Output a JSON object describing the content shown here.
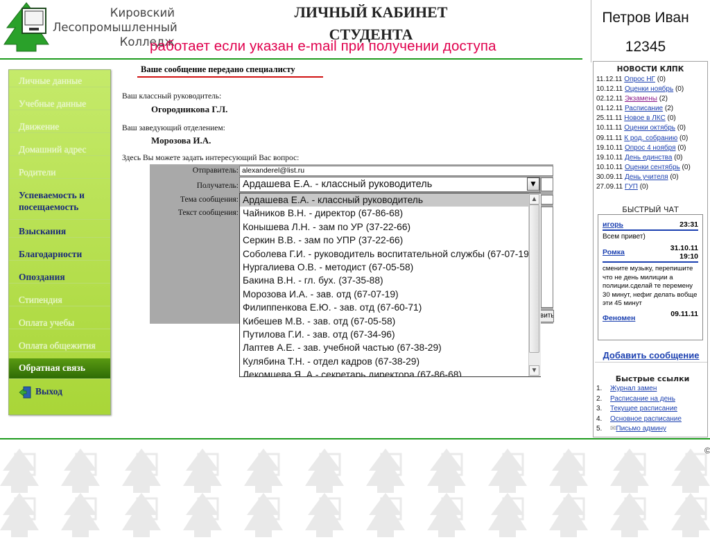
{
  "header": {
    "college_lines": [
      "Кировский",
      "Лесопромышленный",
      "Колледж"
    ],
    "title_line1": "ЛИЧНЫЙ КАБИНЕТ",
    "title_line2": "СТУДЕНТА",
    "note": "работает если указан e-mail при получении доступа",
    "user_name": "Петров Иван",
    "user_id": "12345"
  },
  "sidebar": {
    "items": [
      {
        "label": "Личные данные",
        "state": "dim"
      },
      {
        "label": "Учебные данные",
        "state": "dim"
      },
      {
        "label": "Движение",
        "state": "dim"
      },
      {
        "label": "Домашний адрес",
        "state": "dim"
      },
      {
        "label": "Родители",
        "state": "dim"
      },
      {
        "label": "Успеваемость и посещаемость",
        "state": "active"
      },
      {
        "label": "Взыскания",
        "state": "active"
      },
      {
        "label": "Благодарности",
        "state": "active"
      },
      {
        "label": "Опоздания",
        "state": "active"
      },
      {
        "label": "Стипендия",
        "state": "dim"
      },
      {
        "label": "Оплата учебы",
        "state": "dim"
      },
      {
        "label": "Оплата общежития",
        "state": "dim"
      },
      {
        "label": "Обратная связь",
        "state": "selected"
      }
    ],
    "exit_label": "Выход"
  },
  "main": {
    "message_title": "Ваше сообщение передано специалисту",
    "class_teacher_label": "Ваш классный руководитель:",
    "class_teacher_name": "Огородникова Г.Л.",
    "dept_head_label": "Ваш заведующий отделением:",
    "dept_head_name": "Морозова И.А.",
    "ask_prompt": "Здесь Вы можете задать интересующий Вас вопрос:",
    "form": {
      "sender_label": "Отправитель:",
      "sender_value": "alexanderel@list.ru",
      "recipient_label": "Получатель:",
      "recipient_value": "Ардашева Е.А. - классный руководитель",
      "subject_label": "Тема сообщения:",
      "text_label": "Текст сообщения:",
      "send_label": "Отправить"
    },
    "dropdown_options": [
      "Ардашева Е.А. - классный руководитель",
      "Чайников В.Н. - директор (67-86-68)",
      "Конышева Л.Н. - зам по УР (37-22-66)",
      "Серкин В.В. - зам по УПР (37-22-66)",
      "Соболева Г.И. - руководитель воспитательной службы (67-07-19)",
      "Нургалиева О.В. - методист (67-05-58)",
      "Бакина В.Н. - гл. бух. (37-35-88)",
      "Морозова И.А. - зав. отд (67-07-19)",
      "Филиппенкова Е.Ю. - зав. отд (67-60-71)",
      "Кибешев М.В. - зав. отд (67-05-58)",
      "Путилова Г.И. - зав. отд (67-34-96)",
      "Лаптев А.Е. - зав. учебной частью (67-38-29)",
      "Кулябина Т.Н. - отдел кадров (67-38-29)",
      "Лекомцева Я. А - секретарь директора (67-86-68)"
    ],
    "highlighted_option": 0
  },
  "right_panel": {
    "news_title": "НОВОСТИ КЛПК",
    "news": [
      {
        "date": "11.12.11",
        "link": "Опрос НГ",
        "count": "(0)",
        "visited": false
      },
      {
        "date": "10.12.11",
        "link": "Оценки ноябрь",
        "count": "(0)",
        "visited": false
      },
      {
        "date": "02.12.11",
        "link": "Экзамены",
        "count": "(2)",
        "visited": true
      },
      {
        "date": "01.12.11",
        "link": "Расписание",
        "count": "(2)",
        "visited": false
      },
      {
        "date": "25.11.11",
        "link": "Новое в ЛКС",
        "count": "(0)",
        "visited": false
      },
      {
        "date": "10.11.11",
        "link": "Оценки октябрь",
        "count": "(0)",
        "visited": false
      },
      {
        "date": "09.11.11",
        "link": "К род. собранию",
        "count": "(0)",
        "visited": false
      },
      {
        "date": "19.10.11",
        "link": "Опрос 4 ноября",
        "count": "(0)",
        "visited": false
      },
      {
        "date": "19.10.11",
        "link": "День единства",
        "count": "(0)",
        "visited": false
      },
      {
        "date": "10.10.11",
        "link": "Оценки сентябрь",
        "count": "(0)",
        "visited": false
      },
      {
        "date": "30.09.11",
        "link": "День учителя",
        "count": "(0)",
        "visited": false
      },
      {
        "date": "27.09.11",
        "link": "ГУП",
        "count": "(0)",
        "visited": false
      }
    ],
    "chat_title": "БЫСТРЫЙ ЧАТ",
    "chat": {
      "top_name": "игорь",
      "top_time": "23:31",
      "msg1": "Всем привет)",
      "name2": "Ромка",
      "date2": "31.10.11",
      "time2": "19:10",
      "msg2": "смените музыку, перепишите что не день милиции а полиции.сделай те перемену 30 минут, нефиг делать вобще эти 45 минут",
      "name3": "Феномен",
      "date3": "09.11.11"
    },
    "add_message": "Добавить сообщение",
    "quick_title": "Быстрые ссылки",
    "quick_links": [
      {
        "num": "1.",
        "label": "Журнал замен"
      },
      {
        "num": "2.",
        "label": "Расписание на день"
      },
      {
        "num": "3.",
        "label": "Текущее расписание"
      },
      {
        "num": "4.",
        "label": "Основное расписание"
      },
      {
        "num": "5.",
        "label": "Письмо админу"
      }
    ]
  },
  "footer": {
    "copyright": "©"
  },
  "colors": {
    "green_rule": "#1d9b1d",
    "note_red": "#e0004d",
    "link_blue": "#1a3fb0",
    "sidebar_green": "#a9d638"
  }
}
